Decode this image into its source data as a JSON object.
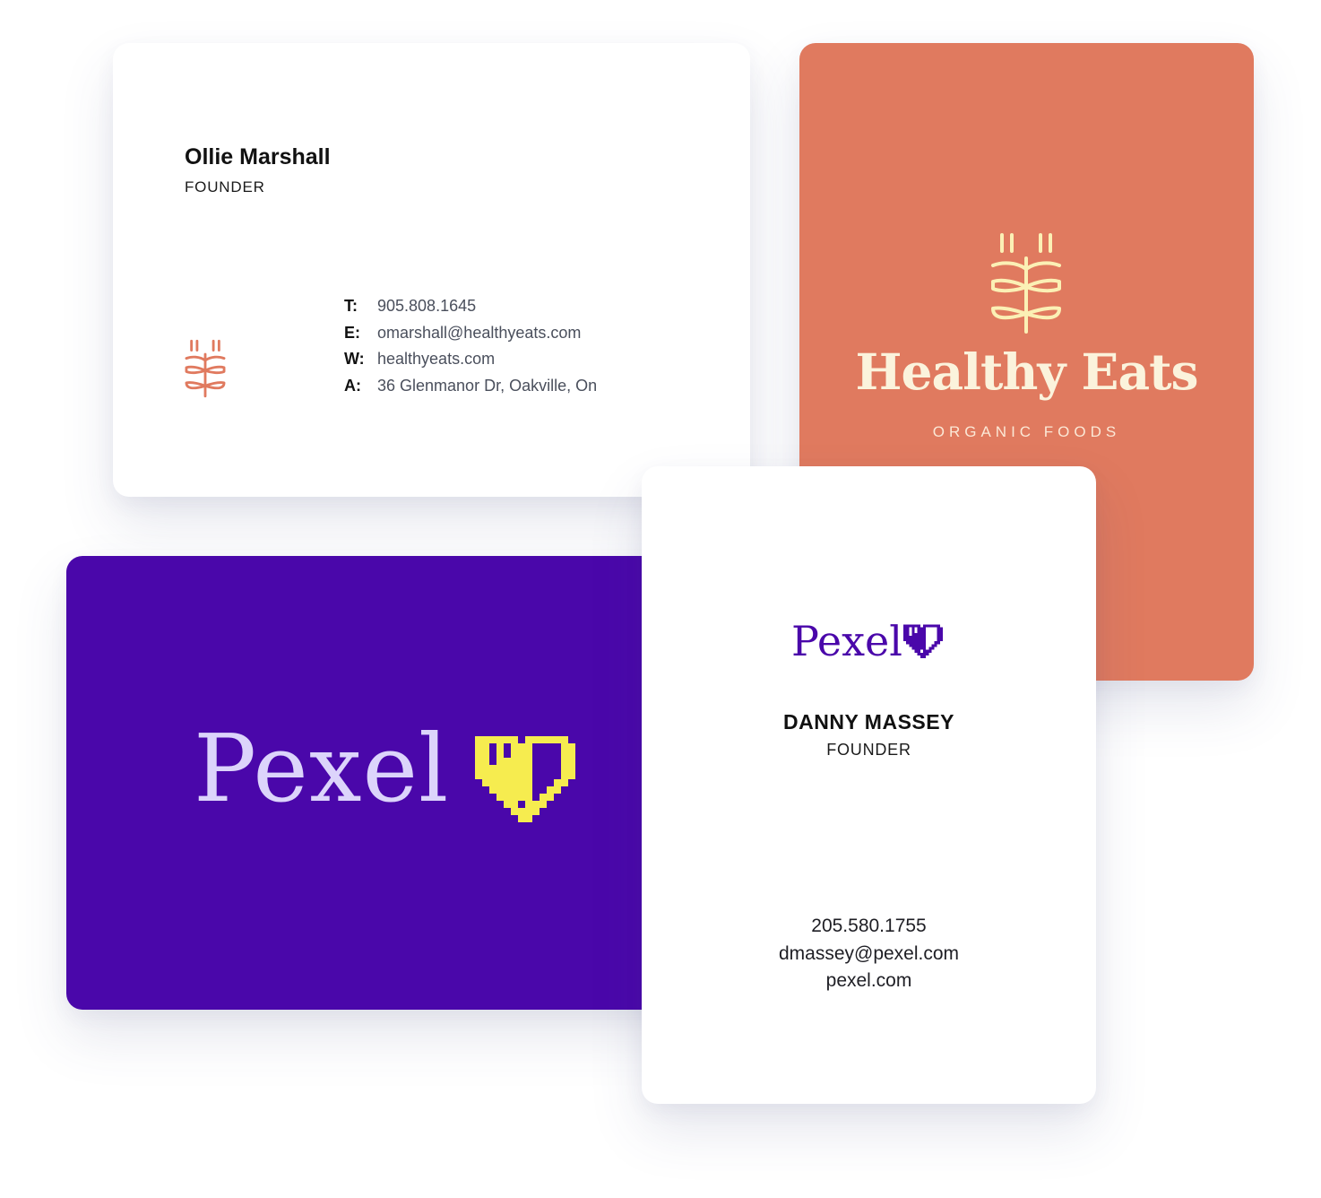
{
  "healthy_eats_front": {
    "name": "Ollie Marshall",
    "role": "FOUNDER",
    "icon": "wheat-icon",
    "icon_color": "#e07a5f",
    "contacts": [
      {
        "key": "T:",
        "value": "905.808.1645"
      },
      {
        "key": "E:",
        "value": "omarshall@healthyeats.com"
      },
      {
        "key": "W:",
        "value": "healthyeats.com"
      },
      {
        "key": "A:",
        "value": "36 Glenmanor Dr, Oakville, On"
      }
    ]
  },
  "healthy_eats_back": {
    "background": "#e07a5f",
    "icon": "wheat-icon",
    "icon_color": "#fbf0b5",
    "brand": "Healthy Eats",
    "tagline": "ORGANIC FOODS"
  },
  "pexel_back": {
    "background": "#4a07aa",
    "wordmark": "Pexel",
    "wordmark_color": "#dcd4fb",
    "icon": "pixel-heart-icon",
    "icon_color": "#f6ec4f"
  },
  "pexel_front": {
    "wordmark": "Pexel",
    "icon": "pixel-heart-icon",
    "accent": "#4a07aa",
    "name": "DANNY MASSEY",
    "role": "FOUNDER",
    "phone": "205.580.1755",
    "email": "dmassey@pexel.com",
    "website": "pexel.com"
  }
}
